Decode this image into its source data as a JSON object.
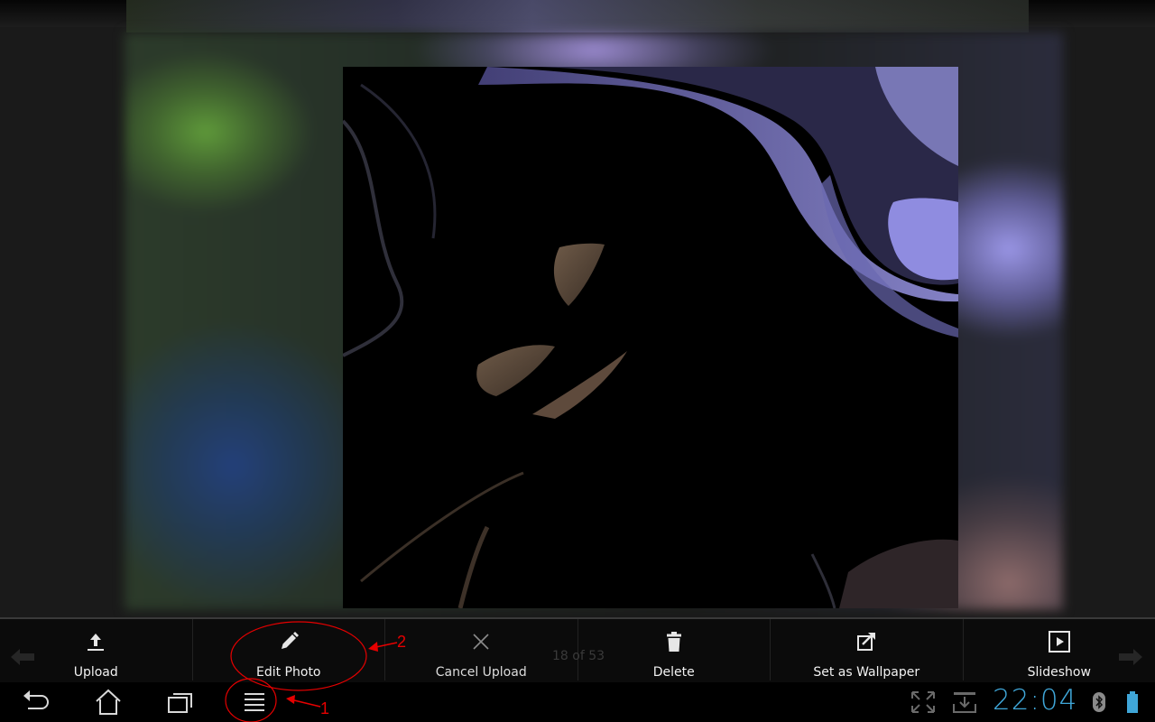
{
  "gallery": {
    "photo_counter": "18 of 53",
    "actions": [
      {
        "label": "Upload",
        "icon": "upload-icon"
      },
      {
        "label": "Edit Photo",
        "icon": "pencil-icon"
      },
      {
        "label": "Cancel Upload",
        "icon": "close-icon"
      },
      {
        "label": "Delete",
        "icon": "trash-icon"
      },
      {
        "label": "Set as Wallpaper",
        "icon": "set-wallpaper-icon"
      },
      {
        "label": "Slideshow",
        "icon": "play-icon"
      }
    ]
  },
  "system_bar": {
    "clock": "22:04",
    "buttons": [
      "back-icon",
      "home-icon",
      "recent-apps-icon",
      "menu-icon"
    ],
    "status_icons": [
      "fullscreen-icon",
      "download-icon",
      "bluetooth-icon",
      "battery-icon"
    ]
  },
  "annotations": {
    "marker_1": "1",
    "marker_2": "2"
  },
  "colors": {
    "clock": "#3fa6d8",
    "annotation": "#e60000",
    "battery": "#3fa6d8"
  }
}
